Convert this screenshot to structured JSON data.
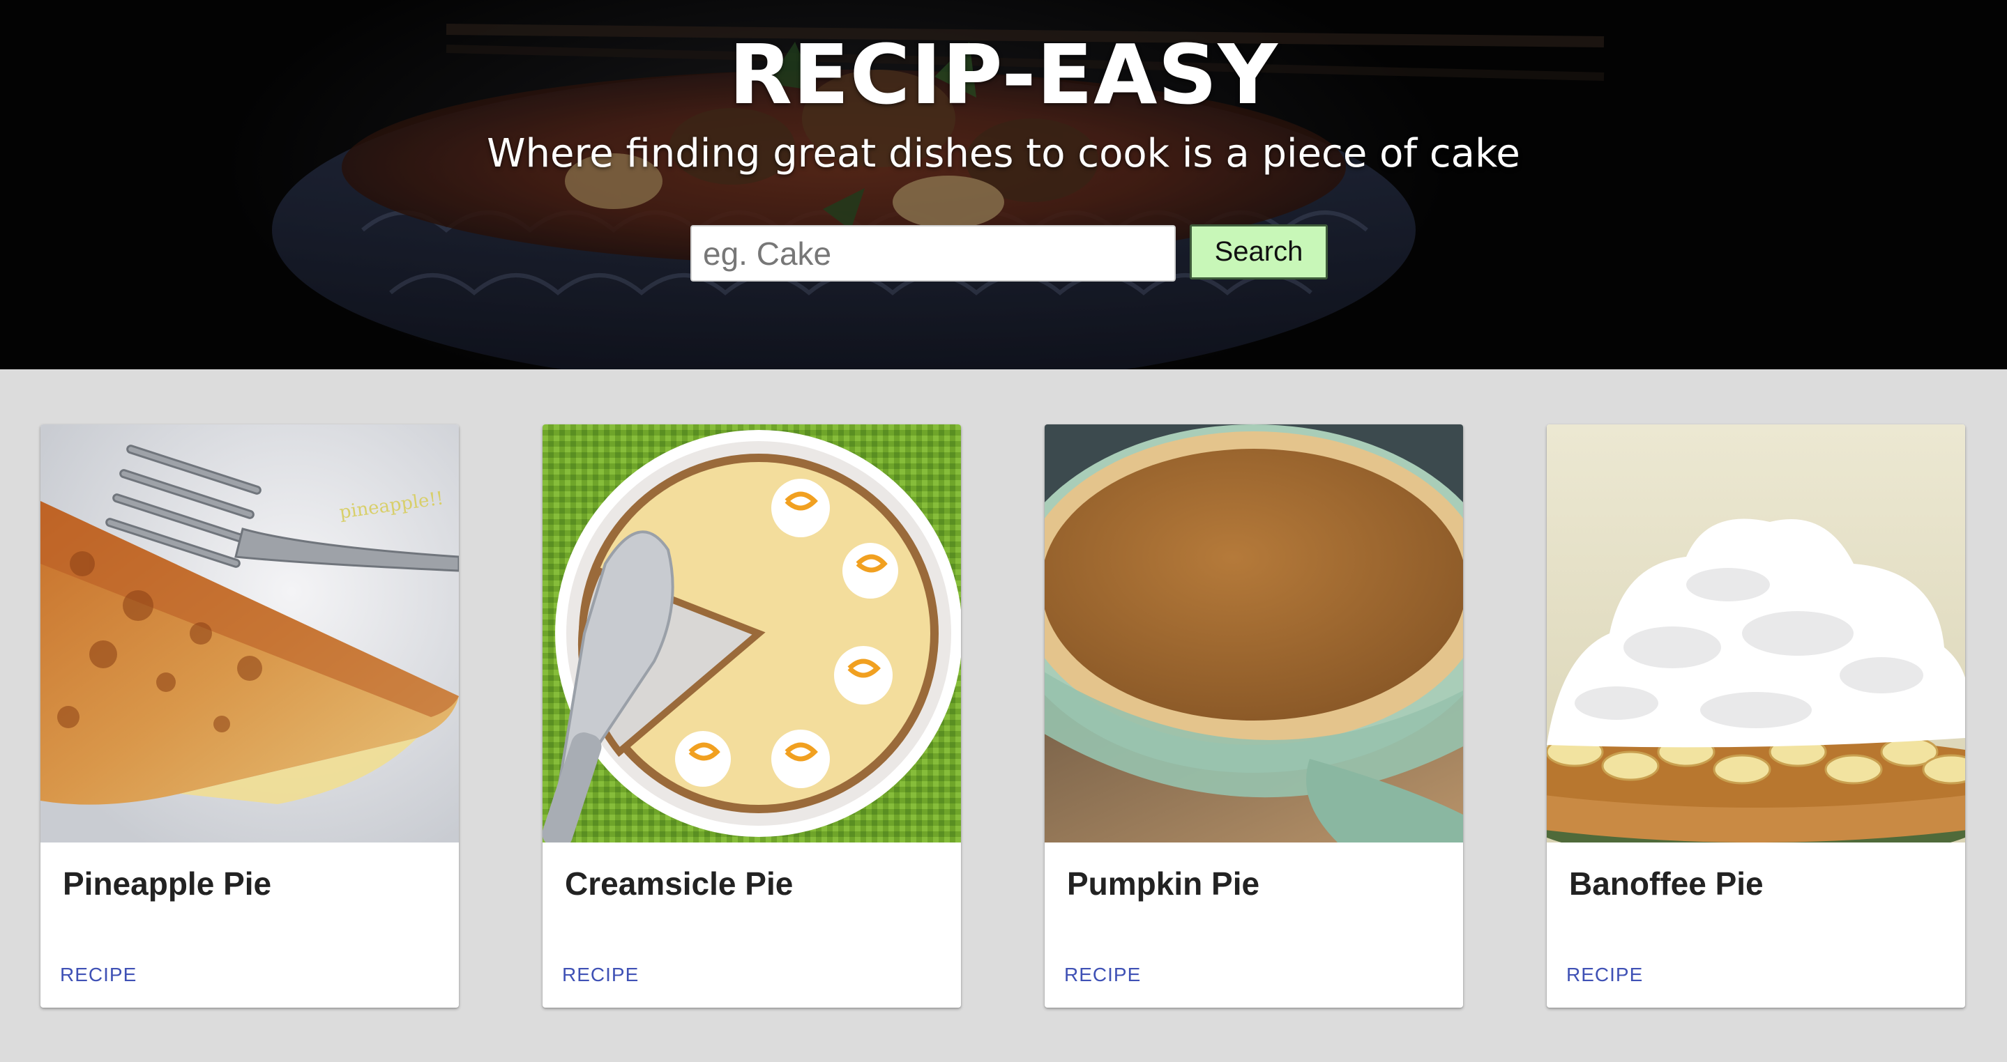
{
  "hero": {
    "title": "RECIP-EASY",
    "subtitle": "Where finding great dishes to cook is a piece of cake",
    "search_placeholder": "eg. Cake",
    "search_value": "",
    "search_button_label": "Search"
  },
  "cards": [
    {
      "title": "Pineapple Pie",
      "link_label": "Recipe",
      "image_icon": "pineapple-pie-photo"
    },
    {
      "title": "Creamsicle Pie",
      "link_label": "Recipe",
      "image_icon": "creamsicle-pie-photo"
    },
    {
      "title": "Pumpkin Pie",
      "link_label": "Recipe",
      "image_icon": "pumpkin-pie-photo"
    },
    {
      "title": "Banoffee Pie",
      "link_label": "Recipe",
      "image_icon": "banoffee-pie-photo"
    }
  ],
  "colors": {
    "page_background": "#dcdcdc",
    "search_button_background": "#c8f7b8",
    "link_accent": "#3f51b5"
  }
}
